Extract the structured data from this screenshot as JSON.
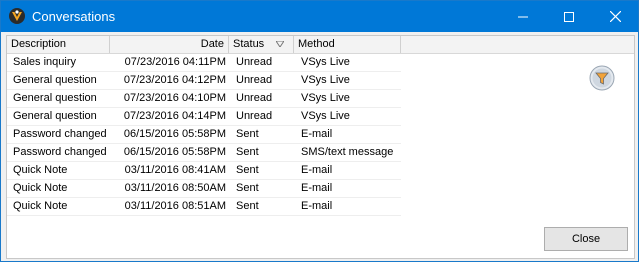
{
  "window": {
    "title": "Conversations"
  },
  "table": {
    "headers": {
      "description": "Description",
      "date": "Date",
      "status": "Status",
      "method": "Method"
    },
    "rows": [
      {
        "description": "Sales inquiry",
        "date": "07/23/2016 04:11PM",
        "status": "Unread",
        "method": "VSys Live"
      },
      {
        "description": "General question",
        "date": "07/23/2016 04:12PM",
        "status": "Unread",
        "method": "VSys Live"
      },
      {
        "description": "General question",
        "date": "07/23/2016 04:10PM",
        "status": "Unread",
        "method": "VSys Live"
      },
      {
        "description": "General question",
        "date": "07/23/2016 04:14PM",
        "status": "Unread",
        "method": "VSys Live"
      },
      {
        "description": "Password changed",
        "date": "06/15/2016 05:58PM",
        "status": "Sent",
        "method": "E-mail"
      },
      {
        "description": "Password changed",
        "date": "06/15/2016 05:58PM",
        "status": "Sent",
        "method": "SMS/text message"
      },
      {
        "description": "Quick Note",
        "date": "03/11/2016 08:41AM",
        "status": "Sent",
        "method": "E-mail"
      },
      {
        "description": "Quick Note",
        "date": "03/11/2016 08:50AM",
        "status": "Sent",
        "method": "E-mail"
      },
      {
        "description": "Quick Note",
        "date": "03/11/2016 08:51AM",
        "status": "Sent",
        "method": "E-mail"
      }
    ]
  },
  "buttons": {
    "close": "Close"
  },
  "icons": {
    "app": "app-logo-icon",
    "filter": "filter-icon",
    "sort": "sort-down-icon"
  },
  "colors": {
    "titlebar": "#0078d7",
    "border": "#1979ca"
  }
}
